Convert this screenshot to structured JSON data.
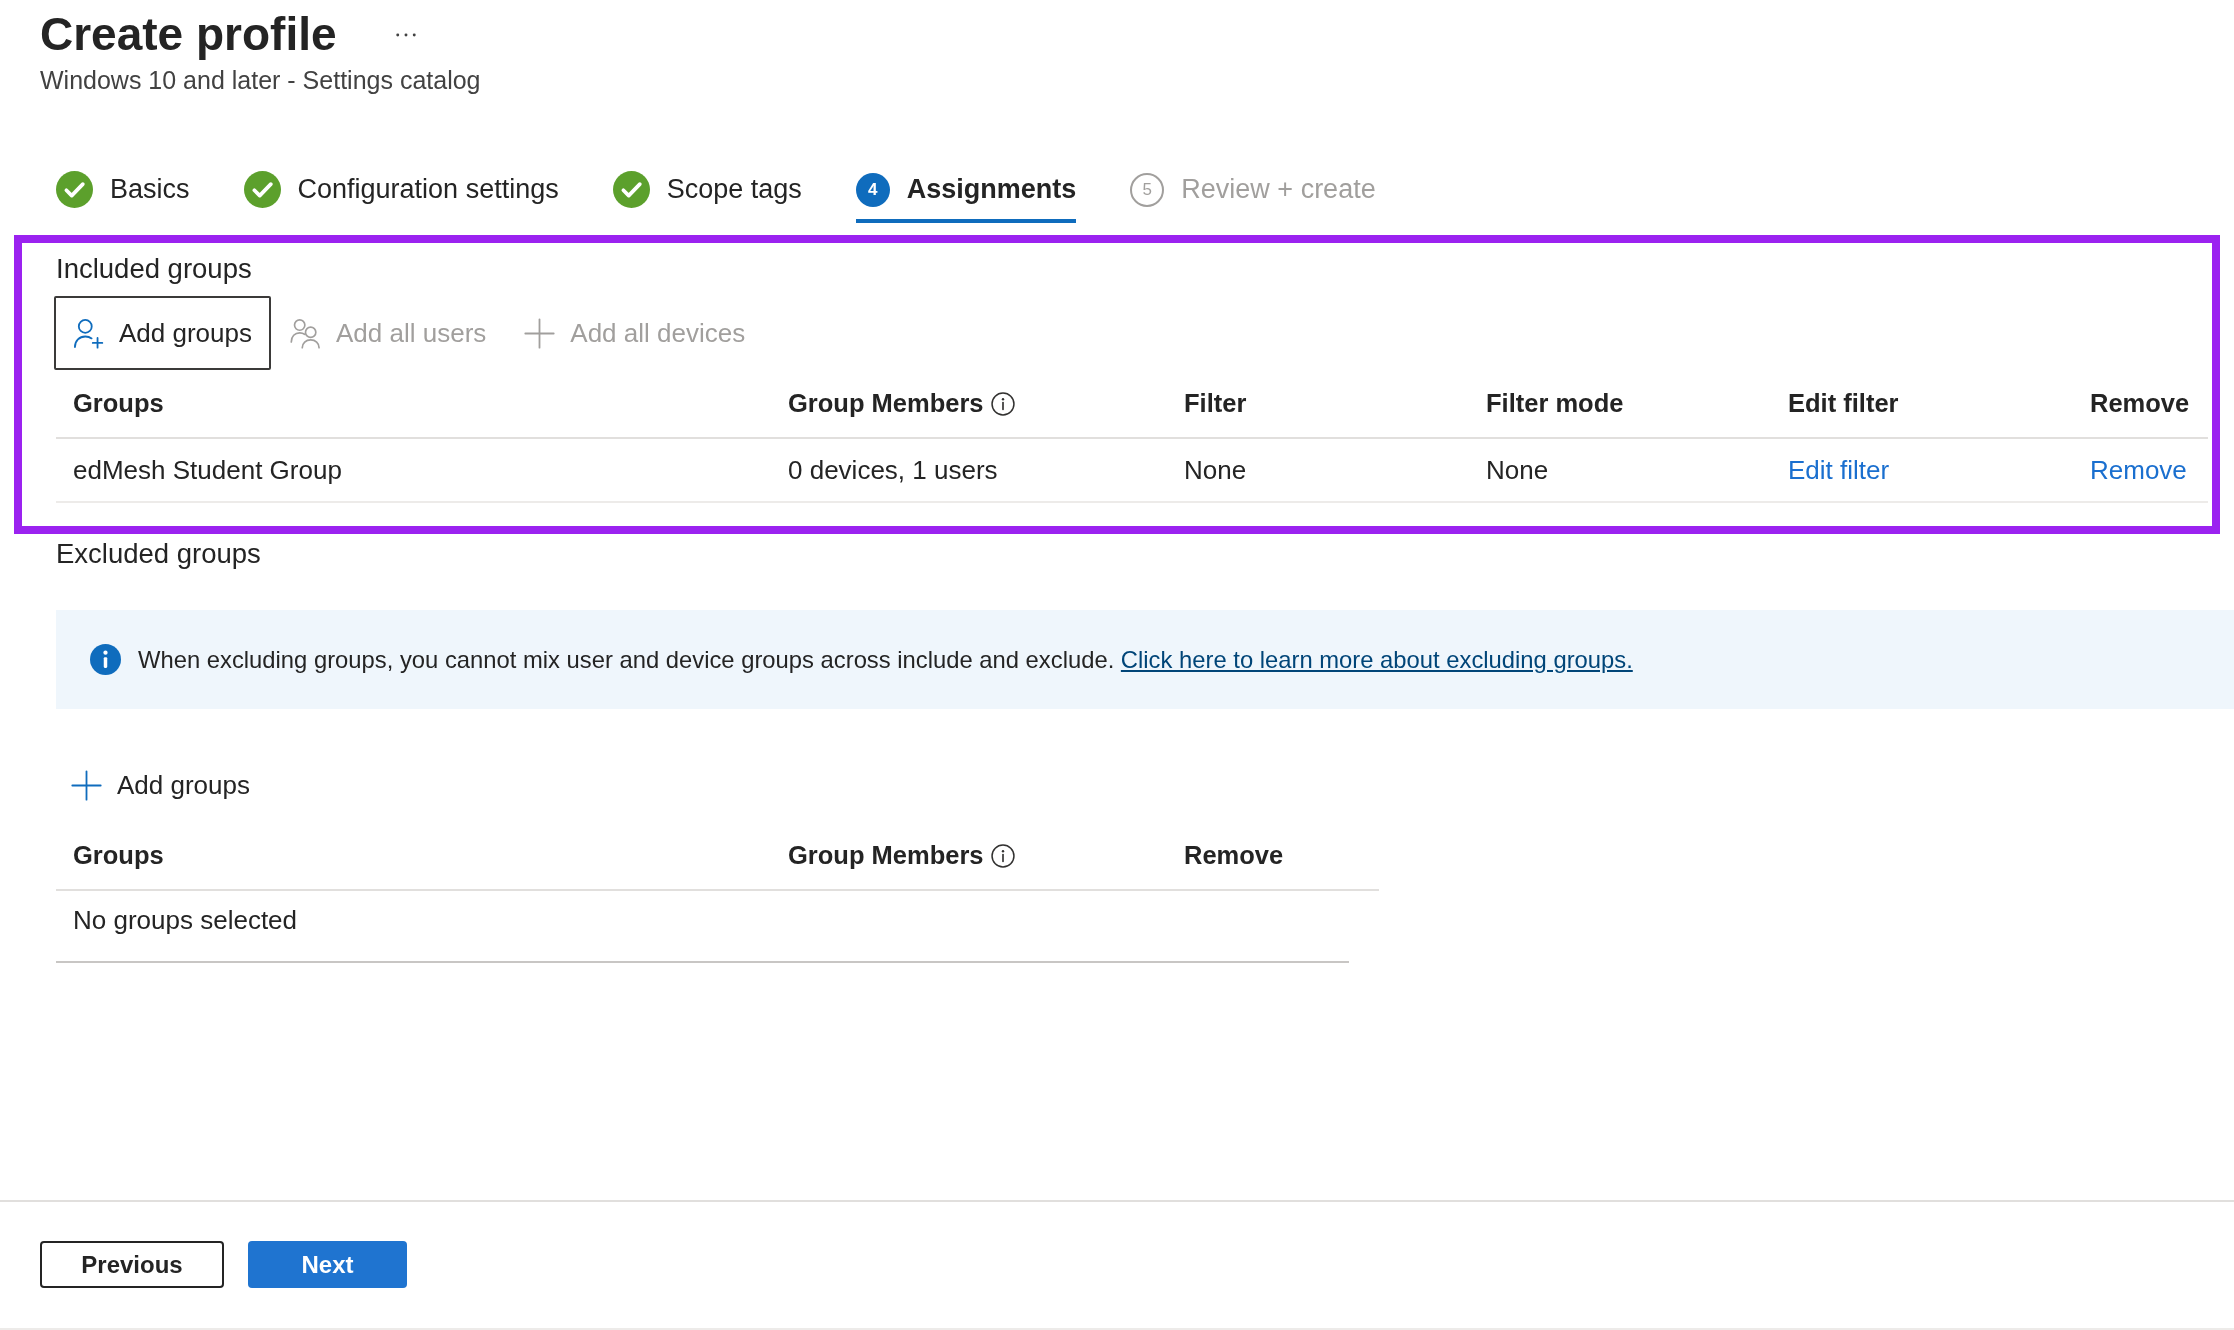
{
  "header": {
    "title": "Create profile",
    "subtitle": "Windows 10 and later - Settings catalog"
  },
  "steps": [
    {
      "label": "Basics",
      "completed": true,
      "disabled": false,
      "selected": false
    },
    {
      "label": "Configuration settings",
      "completed": true,
      "disabled": false,
      "selected": false
    },
    {
      "label": "Scope tags",
      "completed": true,
      "disabled": false,
      "selected": false
    },
    {
      "label": "Assignments",
      "number": "4",
      "completed": false,
      "disabled": false,
      "selected": true
    },
    {
      "label": "Review + create",
      "number": "5",
      "completed": false,
      "disabled": true,
      "selected": false
    }
  ],
  "included_groups": {
    "heading": "Included groups",
    "highlighted": true,
    "toolbar": [
      {
        "label": "Add groups",
        "kind": "person-add",
        "focused": true,
        "disabled": false
      },
      {
        "label": "Add all users",
        "kind": "people",
        "focused": false,
        "disabled": true
      },
      {
        "label": "Add all devices",
        "kind": "plus",
        "focused": false,
        "disabled": true
      }
    ],
    "table": {
      "columns": [
        {
          "label": "Groups",
          "kind": "plain"
        },
        {
          "label": "Group Members",
          "kind": "info"
        },
        {
          "label": "Filter",
          "kind": "plain"
        },
        {
          "label": "Filter mode",
          "kind": "plain"
        },
        {
          "label": "Edit filter",
          "kind": "plain"
        },
        {
          "label": "Remove",
          "kind": "plain"
        }
      ],
      "rows": [
        {
          "cells": [
            {
              "text": "edMesh Student Group",
              "kind": "text"
            },
            {
              "text": "0 devices, 1 users",
              "kind": "text"
            },
            {
              "text": "None",
              "kind": "text"
            },
            {
              "text": "None",
              "kind": "text"
            },
            {
              "text": "Edit filter",
              "kind": "link"
            },
            {
              "text": "Remove",
              "kind": "link"
            }
          ]
        }
      ]
    }
  },
  "excluded_groups": {
    "heading": "Excluded groups",
    "notice": {
      "message": "When excluding groups, you cannot mix user and device groups across include and exclude.",
      "link": "Click here to learn more about excluding groups."
    },
    "toolbar": [
      {
        "label": "Add groups",
        "kind": "plus",
        "focused": false,
        "disabled": false
      }
    ],
    "table": {
      "columns": [
        {
          "label": "Groups",
          "kind": "plain"
        },
        {
          "label": "Group Members",
          "kind": "info"
        },
        {
          "label": "Remove",
          "kind": "plain"
        }
      ],
      "empty_message": "No groups selected"
    }
  },
  "footer": {
    "buttons": [
      {
        "label": "Previous",
        "kind": "secondary"
      },
      {
        "label": "Next",
        "kind": "primary"
      }
    ]
  }
}
